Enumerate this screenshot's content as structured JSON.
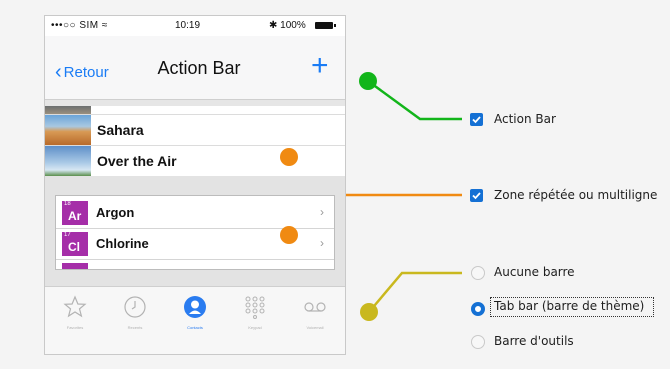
{
  "status_bar": {
    "carrier": "•••○○ SIM ≈",
    "time": "10:19",
    "battery": "✱ 100%"
  },
  "nav": {
    "back": "Retour",
    "back_chevron": "‹",
    "title": "Action Bar",
    "add": "+"
  },
  "list": {
    "items": [
      {
        "label": "Sahara"
      },
      {
        "label": "Over the Air"
      }
    ]
  },
  "repeated_zone": {
    "items": [
      {
        "number": "18",
        "symbol": "Ar",
        "label": "Argon",
        "chevron": "›"
      },
      {
        "number": "17",
        "symbol": "Cl",
        "label": "Chlorine",
        "chevron": "›"
      }
    ]
  },
  "tab_bar": {
    "tabs": [
      {
        "label": "Favorites",
        "icon": "star-icon"
      },
      {
        "label": "Recents",
        "icon": "clock-icon"
      },
      {
        "label": "Contacts",
        "icon": "contact-icon",
        "active": true
      },
      {
        "label": "Keypad",
        "icon": "keypad-icon"
      },
      {
        "label": "Voicemail",
        "icon": "voicemail-icon"
      }
    ]
  },
  "options": {
    "action_bar": {
      "label": "Action Bar",
      "checked": true
    },
    "repeated": {
      "label": "Zone répétée ou multiligne",
      "checked": true
    },
    "bottom_bar": {
      "choices": [
        {
          "label": "Aucune barre",
          "selected": false
        },
        {
          "label": "Tab bar (barre de thème)",
          "selected": true
        },
        {
          "label": "Barre d'outils",
          "selected": false
        }
      ]
    }
  },
  "colors": {
    "green": "#12b51a",
    "orange": "#f08a12",
    "olive": "#c9b81e",
    "accent_blue": "#1470d4",
    "ios_blue": "#1a7cf5",
    "element_purple": "#a52ea8"
  }
}
